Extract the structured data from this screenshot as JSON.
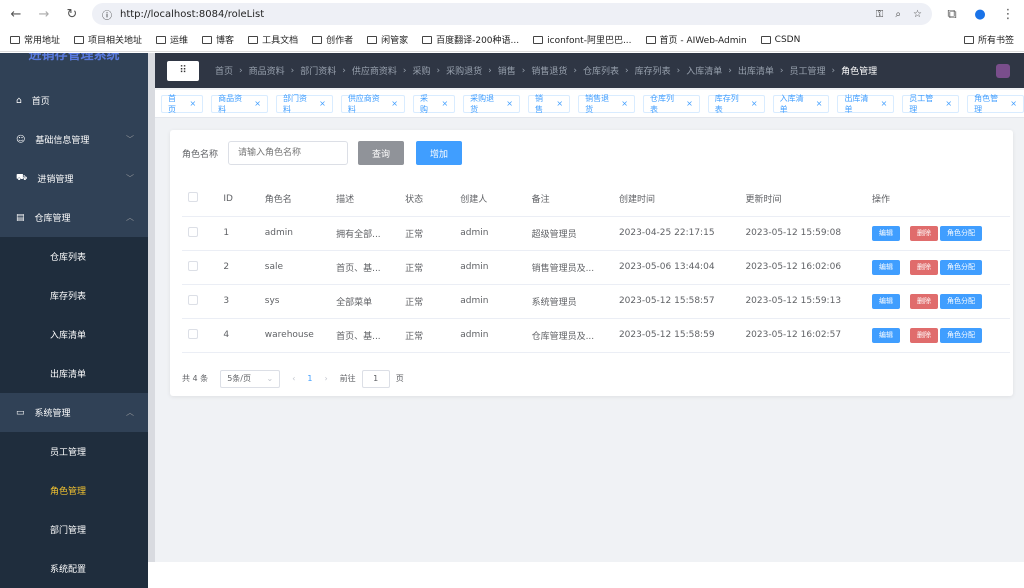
{
  "browser": {
    "url": "http://localhost:8084/roleList",
    "bookmarks": [
      "常用地址",
      "项目相关地址",
      "运维",
      "博客",
      "工具文档",
      "创作者",
      "闲管家",
      "百度翻译-200种语...",
      "iconfont-阿里巴巴...",
      "首页 - AIWeb-Admin",
      "CSDN"
    ],
    "all_bookmarks": "所有书签"
  },
  "sidebar": {
    "title": "进销存管理系统",
    "items": [
      {
        "label": "首页",
        "icon": "home-icon"
      },
      {
        "label": "基础信息管理",
        "icon": "user-icon"
      },
      {
        "label": "进销管理",
        "icon": "cart-icon"
      },
      {
        "label": "仓库管理",
        "icon": "box-icon",
        "children": [
          "仓库列表",
          "库存列表",
          "入库清单",
          "出库清单"
        ]
      },
      {
        "label": "系统管理",
        "icon": "monitor-icon",
        "children": [
          "员工管理",
          "角色管理",
          "部门管理",
          "系统配置"
        ]
      }
    ]
  },
  "breadcrumb": [
    "首页",
    "商品资料",
    "部门资料",
    "供应商资料",
    "采购",
    "采购退货",
    "销售",
    "销售退货",
    "仓库列表",
    "库存列表",
    "入库清单",
    "出库清单",
    "员工管理",
    "角色管理"
  ],
  "tags": [
    "首页",
    "商品资料",
    "部门资料",
    "供应商资料",
    "采购",
    "采购退货",
    "销售",
    "销售退货",
    "仓库列表",
    "库存列表",
    "入库清单",
    "出库清单",
    "员工管理",
    "角色管理"
  ],
  "search": {
    "label": "角色名称",
    "placeholder": "请输入角色名称",
    "query": "查询",
    "add": "增加"
  },
  "table": {
    "headers": [
      "ID",
      "角色名",
      "描述",
      "状态",
      "创建人",
      "备注",
      "创建时间",
      "更新时间",
      "操作"
    ],
    "rows": [
      [
        "1",
        "admin",
        "拥有全部...",
        "正常",
        "admin",
        "超级管理员",
        "2023-04-25 22:17:15",
        "2023-05-12 15:59:08"
      ],
      [
        "2",
        "sale",
        "首页、基...",
        "正常",
        "admin",
        "销售管理员及...",
        "2023-05-06 13:44:04",
        "2023-05-12 16:02:06"
      ],
      [
        "3",
        "sys",
        "全部菜单",
        "正常",
        "admin",
        "系统管理员",
        "2023-05-12 15:58:57",
        "2023-05-12 15:59:13"
      ],
      [
        "4",
        "warehouse",
        "首页、基...",
        "正常",
        "admin",
        "仓库管理员及...",
        "2023-05-12 15:58:59",
        "2023-05-12 16:02:57"
      ]
    ],
    "actions": {
      "edit": "编辑",
      "delete": "删除",
      "assign": "角色分配"
    }
  },
  "pagination": {
    "total": "共 4 条",
    "size": "5条/页",
    "page": "1",
    "goto": "前往",
    "goto_value": "1",
    "page_unit": "页"
  },
  "colors": {
    "primary": "#409eff",
    "danger": "#e06c6c",
    "sidebar": "#304156"
  }
}
